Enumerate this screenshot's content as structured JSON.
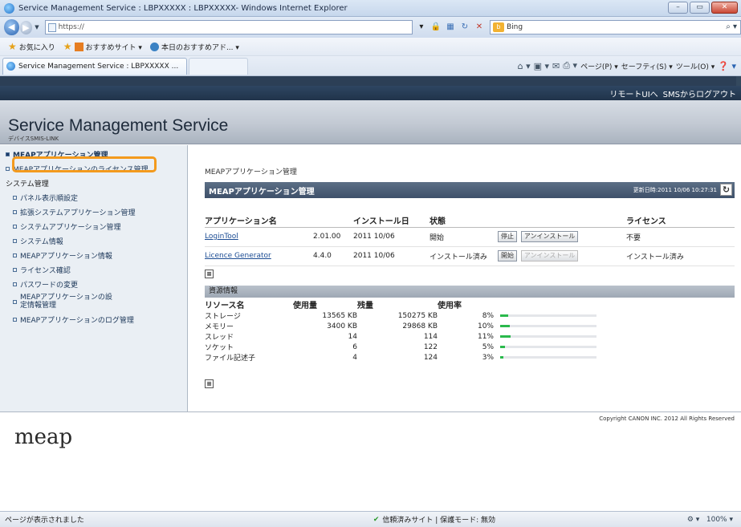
{
  "browser": {
    "window_title": "Service Management Service : LBPXXXXX : LBPXXXXX- Windows Internet Explorer",
    "url": "https://",
    "search_provider": "Bing",
    "favorites_label": "お気に入り",
    "fav_items": [
      "おすすめサイト ▾",
      "本日のおすすめアド... ▾"
    ],
    "tab_title": "Service Management Service : LBPXXXXX ...",
    "commands": [
      "ページ(P) ▾",
      "セーフティ(S) ▾",
      "ツール(O) ▾"
    ],
    "status_text": "ページが表示されました",
    "zone_text": "信頼済みサイト | 保護モード: 無効",
    "zoom": "100%"
  },
  "app": {
    "top_links": [
      "リモートUIへ",
      "SMSからログアウト"
    ],
    "title": "Service Management Service",
    "subtitle": "デバイスSMIS-LINK",
    "sidebar": {
      "items": [
        {
          "label": "MEAPアプリケーション管理",
          "level": "top",
          "active": true
        },
        {
          "label": "MEAPアプリケーションのライセンス管理",
          "level": "top",
          "active": false
        },
        {
          "label": "システム管理",
          "level": "section",
          "active": false
        },
        {
          "label": "パネル表示順設定",
          "level": "sub",
          "active": false
        },
        {
          "label": "拡張システムアプリケーション管理",
          "level": "sub",
          "active": false
        },
        {
          "label": "システムアプリケーション管理",
          "level": "sub",
          "active": false
        },
        {
          "label": "システム情報",
          "level": "sub",
          "active": false
        },
        {
          "label": "MEAPアプリケーション情報",
          "level": "sub",
          "active": false
        },
        {
          "label": "ライセンス確認",
          "level": "sub",
          "active": false
        },
        {
          "label": "パスワードの変更",
          "level": "sub",
          "active": false
        },
        {
          "label": "MEAPアプリケーションの設定情報管理",
          "level": "sub",
          "active": false
        },
        {
          "label": "MEAPアプリケーションのログ管理",
          "level": "sub",
          "active": false
        }
      ]
    },
    "main": {
      "breadcrumb": "MEAPアプリケーション管理",
      "panel_title": "MEAPアプリケーション管理",
      "updated": "更新日時:2011 10/06 10:27:31",
      "columns": [
        "アプリケーション名",
        "インストール日",
        "状態",
        "ライセンス"
      ],
      "apps": [
        {
          "name": "LoginTool",
          "version": "2.01.00",
          "date": "2011 10/06",
          "status": "開始",
          "btn1": "停止",
          "btn2": "アンインストール",
          "btn1_disabled": false,
          "btn2_disabled": false,
          "license": "不要"
        },
        {
          "name": "Licence Generator",
          "version": "4.4.0",
          "date": "2011 10/06",
          "status": "インストール済み",
          "btn1": "開始",
          "btn2": "アンインストール",
          "btn1_disabled": false,
          "btn2_disabled": true,
          "license": "インストール済み"
        }
      ],
      "resource_title": "資源情報",
      "resource_columns": [
        "リソース名",
        "使用量",
        "残量",
        "使用率"
      ],
      "resources": [
        {
          "name": "ストレージ",
          "used": "13565 KB",
          "remain": "150275 KB",
          "rate": "8%",
          "fraction": 0.08
        },
        {
          "name": "メモリー",
          "used": "3400 KB",
          "remain": "29868 KB",
          "rate": "10%",
          "fraction": 0.1
        },
        {
          "name": "スレッド",
          "used": "14",
          "remain": "114",
          "rate": "11%",
          "fraction": 0.11
        },
        {
          "name": "ソケット",
          "used": "6",
          "remain": "122",
          "rate": "5%",
          "fraction": 0.05
        },
        {
          "name": "ファイル記述子",
          "used": "4",
          "remain": "124",
          "rate": "3%",
          "fraction": 0.03
        }
      ]
    },
    "footer": {
      "logo": "meap",
      "copyright": "Copyright CANON INC. 2012 All Rights Reserved"
    }
  }
}
